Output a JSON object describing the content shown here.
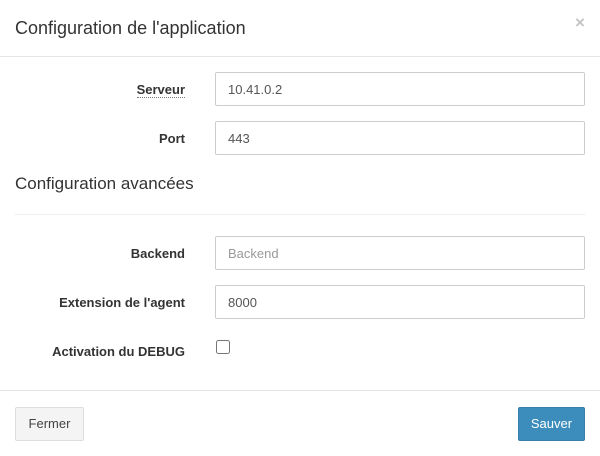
{
  "modal": {
    "title": "Configuration de l'application",
    "close_symbol": "×"
  },
  "form": {
    "server": {
      "label": "Serveur",
      "value": "10.41.0.2"
    },
    "port": {
      "label": "Port",
      "value": "443"
    }
  },
  "advanced": {
    "title": "Configuration avancées",
    "backend": {
      "label": "Backend",
      "value": "",
      "placeholder": "Backend"
    },
    "agent_extension": {
      "label": "Extension de l'agent",
      "value": "8000"
    },
    "debug": {
      "label": "Activation du DEBUG",
      "checked": false
    }
  },
  "footer": {
    "close_label": "Fermer",
    "save_label": "Sauver"
  },
  "colors": {
    "primary": "#3c8dbc",
    "default_button": "#f4f4f4",
    "border": "#cccccc"
  },
  "icons": {
    "close": "close-icon"
  }
}
